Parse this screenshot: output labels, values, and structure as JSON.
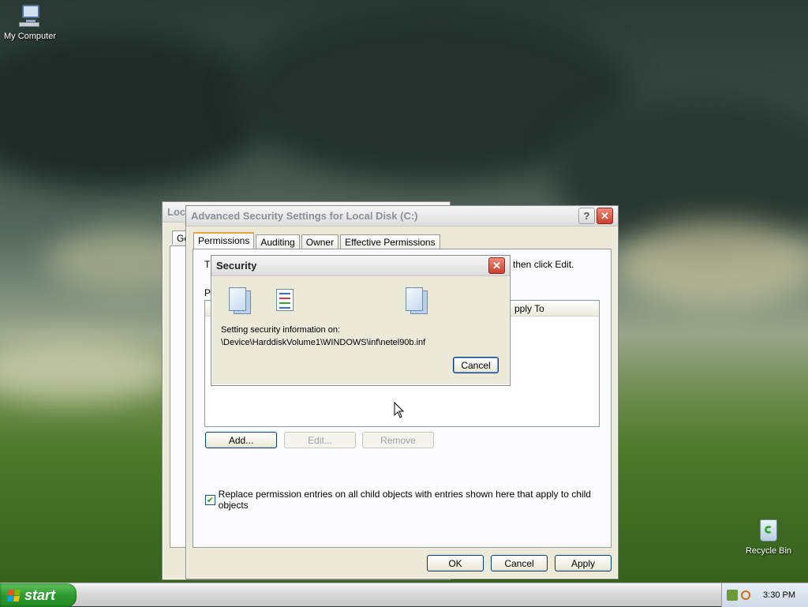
{
  "desktop": {
    "icons": [
      {
        "label": "My Computer"
      },
      {
        "label": "Recycle Bin"
      }
    ]
  },
  "back_window": {
    "title": "Loc",
    "tab_fragment": "Ge"
  },
  "adv_window": {
    "title": "Advanced Security Settings for Local Disk (C:)",
    "tabs": [
      {
        "label": "Permissions",
        "selected": true
      },
      {
        "label": "Auditing"
      },
      {
        "label": "Owner"
      },
      {
        "label": "Effective Permissions"
      }
    ],
    "intro_left": "T",
    "intro_right": "then click Edit.",
    "list_label": "Pe",
    "column_apply_to": "Apply To",
    "column_apply_to_visible": "pply To",
    "buttons": {
      "add": "Add...",
      "edit": "Edit...",
      "remove": "Remove"
    },
    "checkbox_label": "Replace permission entries on all child objects with entries shown here that apply to child objects",
    "checkbox_checked": true,
    "footer_buttons": {
      "ok": "OK",
      "cancel": "Cancel",
      "apply": "Apply"
    }
  },
  "security_dialog": {
    "title": "Security",
    "message_line1": "Setting security information on:",
    "message_line2": "\\Device\\HarddiskVolume1\\WINDOWS\\inf\\netel90b.inf",
    "cancel": "Cancel"
  },
  "taskbar": {
    "start_label": "start",
    "clock": "3:30 PM"
  },
  "colors": {
    "accent": "#e8a33d",
    "start_green": "#2f9a2f",
    "close_red": "#c8412e"
  }
}
